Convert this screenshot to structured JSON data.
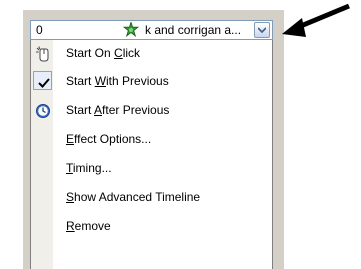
{
  "combo": {
    "index": "0",
    "text": "k and corrigan a...",
    "star_icon": "green-star-icon",
    "dropdown_icon": "chevron-down-icon"
  },
  "menu": {
    "items": [
      {
        "pre": "Start On ",
        "u": "C",
        "post": "lick",
        "icon": "mouse-click-icon"
      },
      {
        "pre": "Start ",
        "u": "W",
        "post": "ith Previous",
        "icon": "checkmark-icon",
        "checked": true
      },
      {
        "pre": "Start ",
        "u": "A",
        "post": "fter Previous",
        "icon": "clock-icon"
      },
      {
        "pre": "",
        "u": "E",
        "post": "ffect Options..."
      },
      {
        "pre": "",
        "u": "T",
        "post": "iming..."
      },
      {
        "pre": "",
        "u": "S",
        "post": "how Advanced Timeline"
      },
      {
        "pre": "",
        "u": "R",
        "post": "emove"
      }
    ]
  },
  "colors": {
    "frame": "#d4d0c8",
    "border": "#7f9db9",
    "check_bg": "#e8eef9"
  },
  "pointer_arrow": "arrow-pointer-icon"
}
